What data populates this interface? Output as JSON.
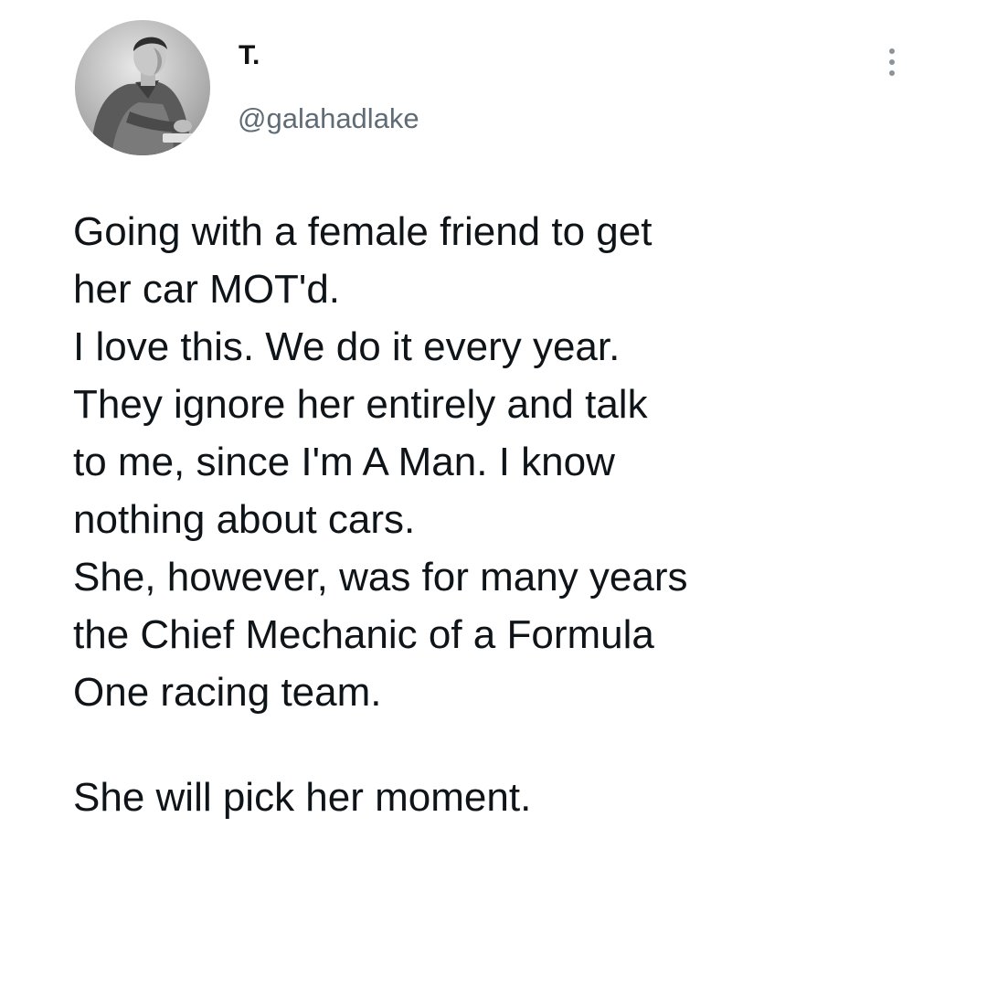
{
  "tweet": {
    "author": {
      "display_name": "T.",
      "handle": "@galahadlake",
      "avatar_icon": "avatar-photo"
    },
    "more_icon": "more-vertical-icon",
    "paragraphs": [
      [
        "Going with a female friend to get",
        "her car MOT'd.",
        "I love this. We do it every year.",
        "They ignore her entirely and talk",
        "to me, since I'm A Man. I know",
        "nothing about cars.",
        "She, however, was for many years",
        "the Chief Mechanic of a Formula",
        "One racing team."
      ],
      [
        "She will pick her moment."
      ]
    ]
  }
}
